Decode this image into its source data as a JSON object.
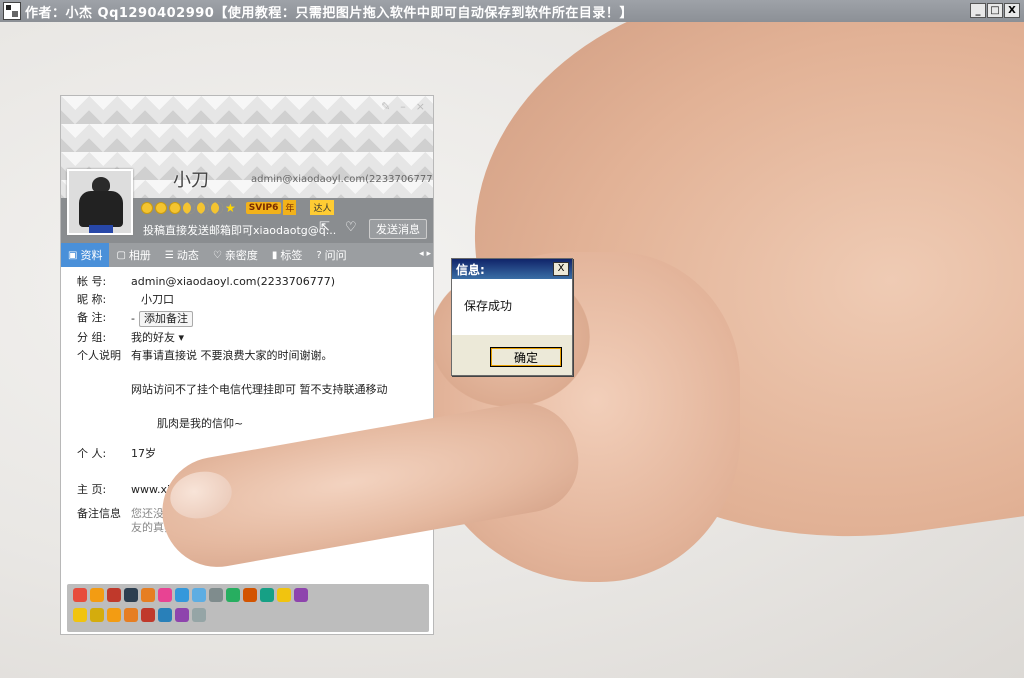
{
  "window": {
    "title": "作者：小杰  Qq1290402990【使用教程：只需把图片拖入软件中即可自动保存到软件所在目录！】",
    "minimize": "_",
    "maximize": "□",
    "close": "X"
  },
  "profile": {
    "nickname": "小刀",
    "header_account": "admin@xiaodaoyl.com(2233706777)",
    "badges": {
      "svip": "SVIP6",
      "year": "年",
      "daren": "达人"
    },
    "signature": "投稿直接发送邮箱即可xiaodaotg@q...",
    "send_label": "发送消息",
    "tabs": [
      {
        "label": "资料",
        "icon": "id-card-icon"
      },
      {
        "label": "相册",
        "icon": "photo-icon"
      },
      {
        "label": "动态",
        "icon": "feed-icon"
      },
      {
        "label": "亲密度",
        "icon": "heart-icon"
      },
      {
        "label": "标签",
        "icon": "tag-icon"
      },
      {
        "label": "问问",
        "icon": "question-icon"
      }
    ],
    "tab_arrows": "◂ ▸",
    "fields": {
      "account_label": "帐    号:",
      "account_value": "admin@xiaodaoyl.com(2233706777)",
      "nick_label": "昵    称:",
      "nick_value": "小刀口",
      "remark_label": "备    注:",
      "remark_value": "-",
      "remark_button": "添加备注",
      "group_label": "分    组:",
      "group_value": "我的好友 ▾",
      "desc_label": "个人说明",
      "desc_line1": "有事请直接说 不要浪费大家的时间谢谢。",
      "desc_line2": "网站访问不了挂个电信代理挂即可 暂不支持联通移动",
      "desc_line3": "肌肉是我的信仰~",
      "personal_label": "个    人:",
      "personal_value": "17岁",
      "homepage_label": "主    页:",
      "homepage_value": "www.xi",
      "remarkinfo_label": "备注信息",
      "remarkinfo_value1": "您还没",
      "remarkinfo_value2": "友的真实"
    }
  },
  "dialog": {
    "title": "信息:",
    "message": "保存成功",
    "ok_label": "确定",
    "close": "X"
  },
  "colors": {
    "tab_active": "#4a90d9",
    "dialog_title": "#10246a",
    "titlebar": "#9ea2a8"
  }
}
